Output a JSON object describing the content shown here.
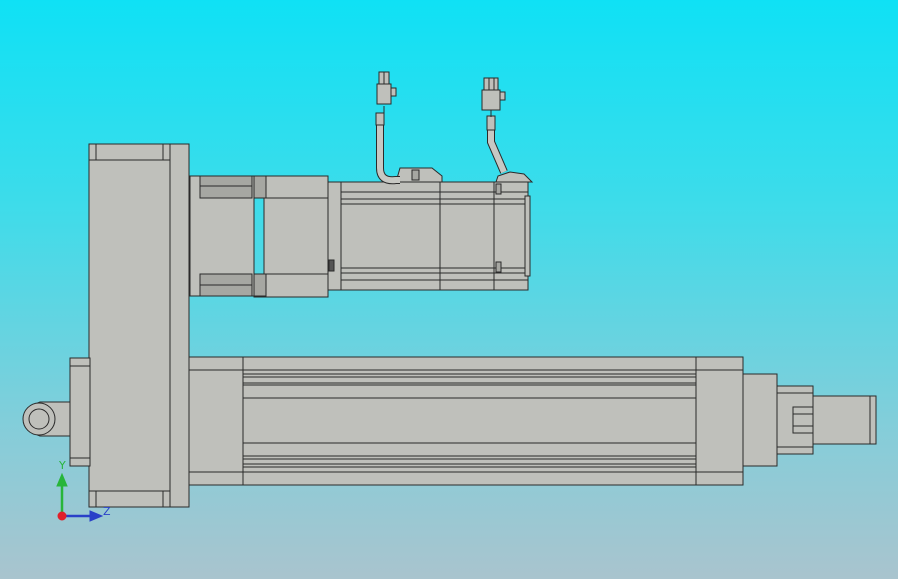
{
  "viewport": {
    "background_top": "#0fe1f5",
    "background_bottom": "#a9c4ce"
  },
  "model": {
    "fill": "#bfc0bb",
    "fill_dark": "#a6a7a2",
    "outline": "#2a2a2a"
  },
  "triad": {
    "y_label": "Y",
    "z_label": "Z",
    "y_color": "#27b53a",
    "z_color": "#2a40c8",
    "x_color": "#e0202a"
  }
}
